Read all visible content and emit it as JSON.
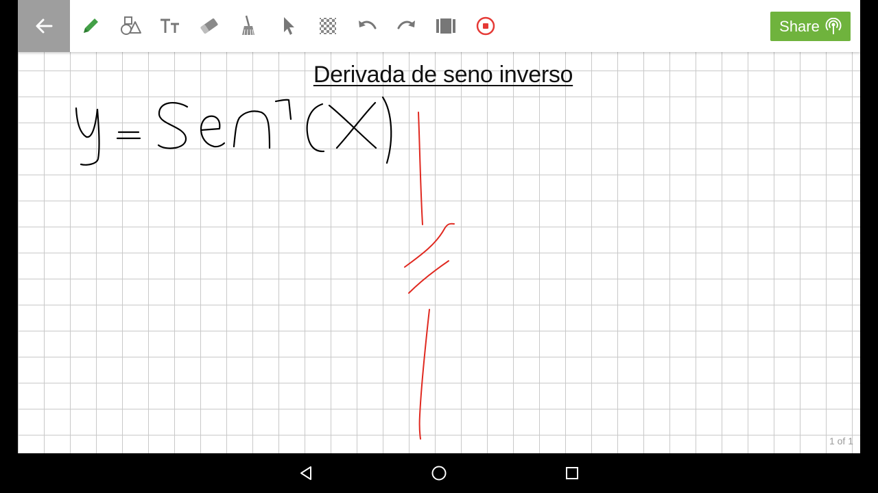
{
  "toolbar": {
    "icons": {
      "back": "arrow-back-icon",
      "pencil": "pencil-icon",
      "shapes": "shapes-icon",
      "text": "text-icon",
      "eraser": "eraser-icon",
      "broom": "clear-broom-icon",
      "select": "pointer-icon",
      "background": "checkerboard-icon",
      "undo": "undo-icon",
      "redo": "redo-icon",
      "pages": "pages-icon",
      "record": "record-icon"
    },
    "share_label": "Share"
  },
  "canvas": {
    "title": "Derivada de seno inverso",
    "page_indicator": "1 of 1"
  },
  "colors": {
    "accent_green": "#6fb33d",
    "pencil_green": "#43a047",
    "record_red": "#e53935",
    "ink_red": "#e0281f",
    "ink_black": "#000000"
  },
  "navbar": {
    "icons": [
      "nav-back-icon",
      "nav-home-icon",
      "nav-recents-icon"
    ]
  }
}
